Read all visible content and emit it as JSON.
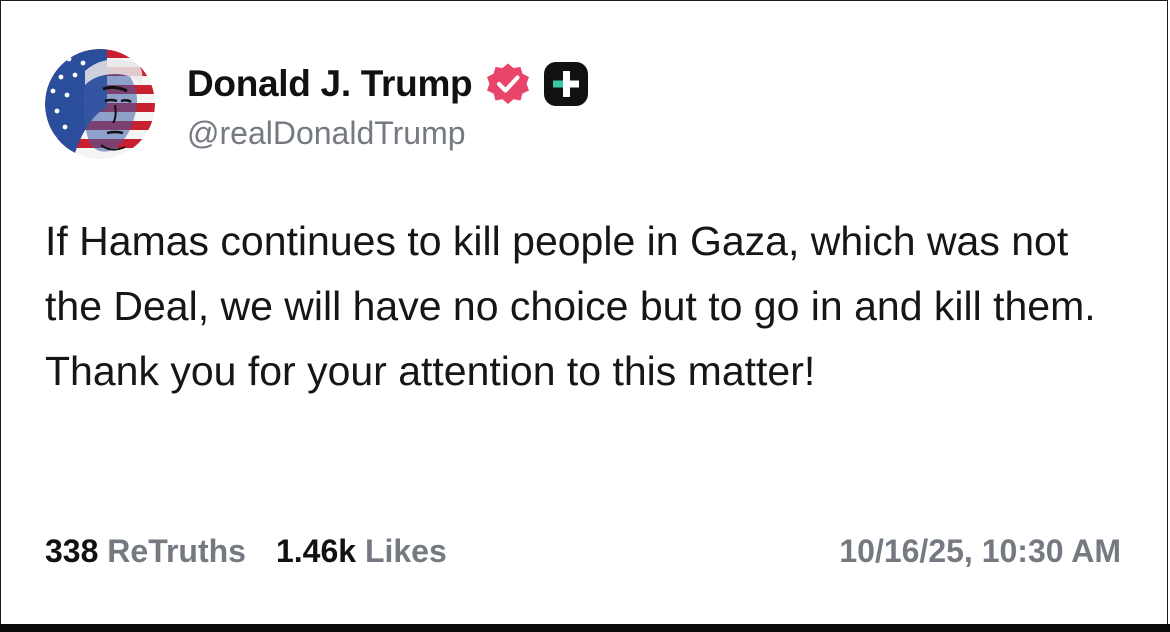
{
  "author": {
    "display_name": "Donald J. Trump",
    "handle": "@realDonaldTrump",
    "avatar_icon": "flag-portrait-avatar",
    "verified_icon": "verified-badge-icon",
    "plus_icon": "truth-plus-badge-icon"
  },
  "post": {
    "text": "If Hamas continues to kill people in Gaza, which was not the Deal, we will have no choice but to go in and kill them. Thank you for your attention to this matter!"
  },
  "stats": {
    "retruths_count": "338",
    "retruths_label": "ReTruths",
    "likes_count": "1.46k",
    "likes_label": "Likes"
  },
  "timestamp": "10/16/25, 10:30 AM",
  "colors": {
    "text_primary": "#111111",
    "text_secondary": "#757a82",
    "verified_badge": "#e9456a",
    "plus_badge_bg": "#111111",
    "plus_badge_accent": "#36c9a7"
  }
}
